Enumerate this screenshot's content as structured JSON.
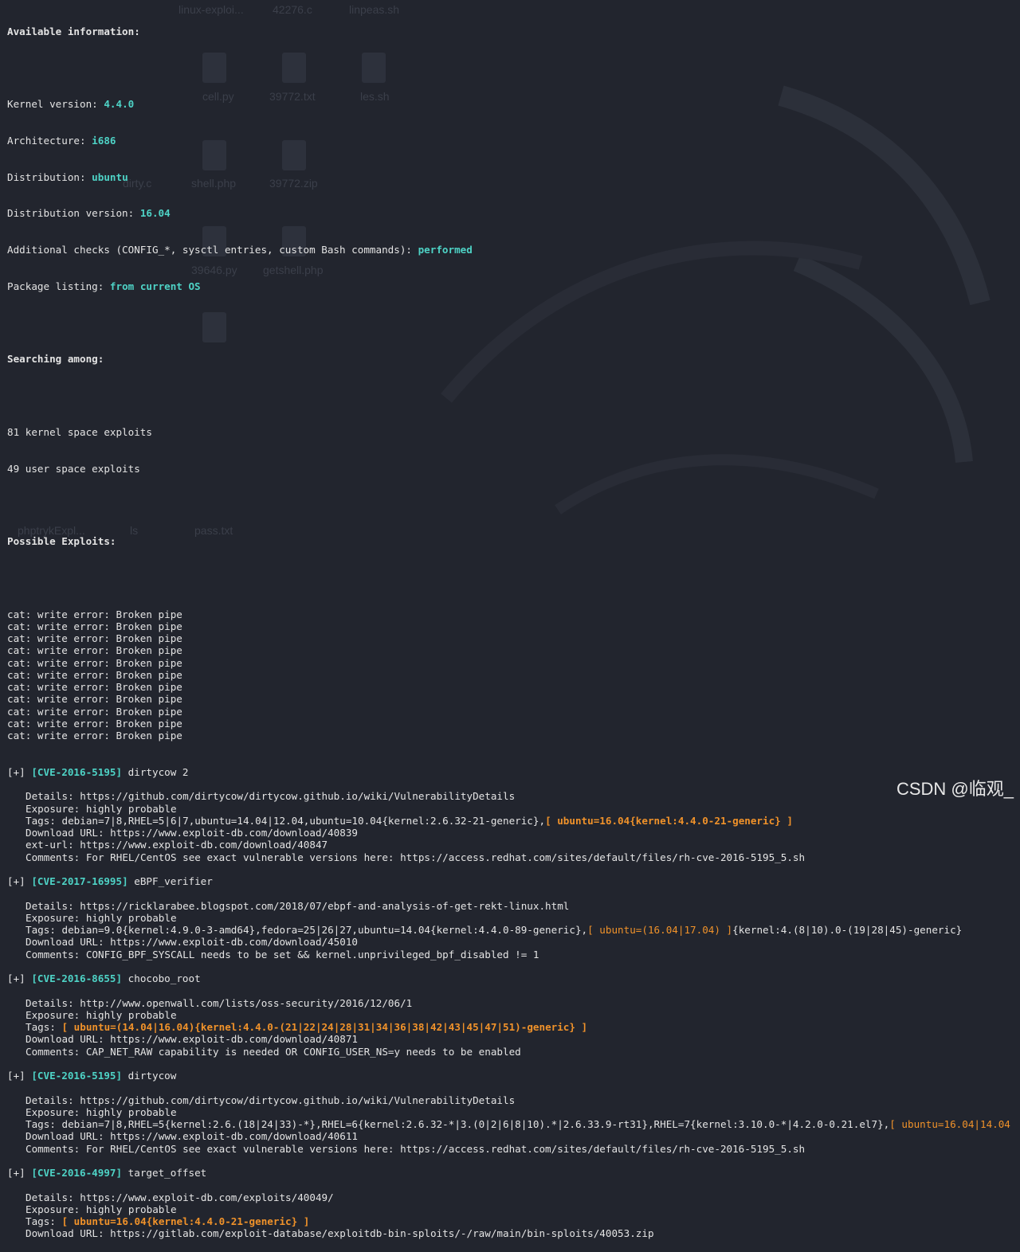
{
  "info": {
    "heading": "Available information:",
    "kernel_label": "Kernel version: ",
    "kernel_value": "4.4.0",
    "arch_label": "Architecture: ",
    "arch_value": "i686",
    "dist_label": "Distribution: ",
    "dist_value": "ubuntu",
    "distver_label": "Distribution version: ",
    "distver_value": "16.04",
    "checks_label": "Additional checks (CONFIG_*, sysctl entries, custom Bash commands): ",
    "checks_value": "performed",
    "pkg_label": "Package listing: ",
    "pkg_value": "from current OS"
  },
  "search": {
    "heading": "Searching among:",
    "kernel_count": "81 kernel space exploits",
    "user_count": "49 user space exploits"
  },
  "possible_heading": "Possible Exploits:",
  "pipe_errors": [
    "cat: write error: Broken pipe",
    "cat: write error: Broken pipe",
    "cat: write error: Broken pipe",
    "cat: write error: Broken pipe",
    "cat: write error: Broken pipe",
    "cat: write error: Broken pipe",
    "cat: write error: Broken pipe",
    "cat: write error: Broken pipe",
    "cat: write error: Broken pipe",
    "cat: write error: Broken pipe",
    "cat: write error: Broken pipe"
  ],
  "exploits": [
    {
      "prefix": "[+] ",
      "cve": "[CVE-2016-5195]",
      "name": " dirtycow 2",
      "details": "Details: https://github.com/dirtycow/dirtycow.github.io/wiki/VulnerabilityDetails",
      "exposure": "Exposure: highly probable",
      "tags_pre": "Tags: debian=7|8,RHEL=5|6|7,ubuntu=14.04|12.04,ubuntu=10.04{kernel:2.6.32-21-generic},",
      "tags_hl": "[ ubuntu=16.04{kernel:4.4.0-21-generic} ]",
      "tags_hl_bold": true,
      "tags_post": "",
      "extra": [
        "Download URL: https://www.exploit-db.com/download/40839",
        "ext-url: https://www.exploit-db.com/download/40847",
        "Comments: For RHEL/CentOS see exact vulnerable versions here: https://access.redhat.com/sites/default/files/rh-cve-2016-5195_5.sh"
      ]
    },
    {
      "prefix": "[+] ",
      "cve": "[CVE-2017-16995]",
      "name": " eBPF_verifier",
      "details": "Details: https://ricklarabee.blogspot.com/2018/07/ebpf-and-analysis-of-get-rekt-linux.html",
      "exposure": "Exposure: highly probable",
      "tags_pre": "Tags: debian=9.0{kernel:4.9.0-3-amd64},fedora=25|26|27,ubuntu=14.04{kernel:4.4.0-89-generic},",
      "tags_hl": "[ ubuntu=(16.04|17.04) ]",
      "tags_hl_bold": false,
      "tags_post": "{kernel:4.(8|10).0-(19|28|45)-generic}",
      "extra": [
        "Download URL: https://www.exploit-db.com/download/45010",
        "Comments: CONFIG_BPF_SYSCALL needs to be set && kernel.unprivileged_bpf_disabled != 1"
      ]
    },
    {
      "prefix": "[+] ",
      "cve": "[CVE-2016-8655]",
      "name": " chocobo_root",
      "details": "Details: http://www.openwall.com/lists/oss-security/2016/12/06/1",
      "exposure": "Exposure: highly probable",
      "tags_pre": "Tags: ",
      "tags_hl": "[ ubuntu=(14.04|16.04){kernel:4.4.0-(21|22|24|28|31|34|36|38|42|43|45|47|51)-generic} ]",
      "tags_hl_bold": true,
      "tags_post": "",
      "extra": [
        "Download URL: https://www.exploit-db.com/download/40871",
        "Comments: CAP_NET_RAW capability is needed OR CONFIG_USER_NS=y needs to be enabled"
      ]
    },
    {
      "prefix": "[+] ",
      "cve": "[CVE-2016-5195]",
      "name": " dirtycow",
      "details": "Details: https://github.com/dirtycow/dirtycow.github.io/wiki/VulnerabilityDetails",
      "exposure": "Exposure: highly probable",
      "tags_pre": "Tags: debian=7|8,RHEL=5{kernel:2.6.(18|24|33)-*},RHEL=6{kernel:2.6.32-*|3.(0|2|6|8|10).*|2.6.33.9-rt31},RHEL=7{kernel:3.10.0-*|4.2.0-0.21.el7},",
      "tags_hl": "[ ubuntu=16.04|14.04",
      "tags_hl_bold": false,
      "tags_post": "",
      "extra": [
        "Download URL: https://www.exploit-db.com/download/40611",
        "Comments: For RHEL/CentOS see exact vulnerable versions here: https://access.redhat.com/sites/default/files/rh-cve-2016-5195_5.sh"
      ]
    },
    {
      "prefix": "[+] ",
      "cve": "[CVE-2016-4997]",
      "name": " target_offset",
      "details": "Details: https://www.exploit-db.com/exploits/40049/",
      "exposure": "Exposure: highly probable",
      "tags_pre": "Tags: ",
      "tags_hl": "[ ubuntu=16.04{kernel:4.4.0-21-generic} ]",
      "tags_hl_bold": true,
      "tags_post": "",
      "extra": [
        "Download URL: https://gitlab.com/exploit-database/exploitdb-bin-sploits/-/raw/main/bin-sploits/40053.zip"
      ]
    }
  ],
  "desktop_labels": [
    "linux-exploi...",
    "42276.c",
    "linpeas.sh",
    "cell.py",
    "39772.txt",
    "les.sh",
    "dirty.c",
    "shell.php",
    "39772.zip",
    "39646.py",
    "getshell.php",
    "phptrykExpl...",
    "ls",
    "pass.txt"
  ],
  "watermark": "CSDN @临观_",
  "colors": {
    "background": "#22252e",
    "text": "#e4e4e4",
    "cve": "#4ed3c6",
    "highlight": "#f0922a"
  }
}
